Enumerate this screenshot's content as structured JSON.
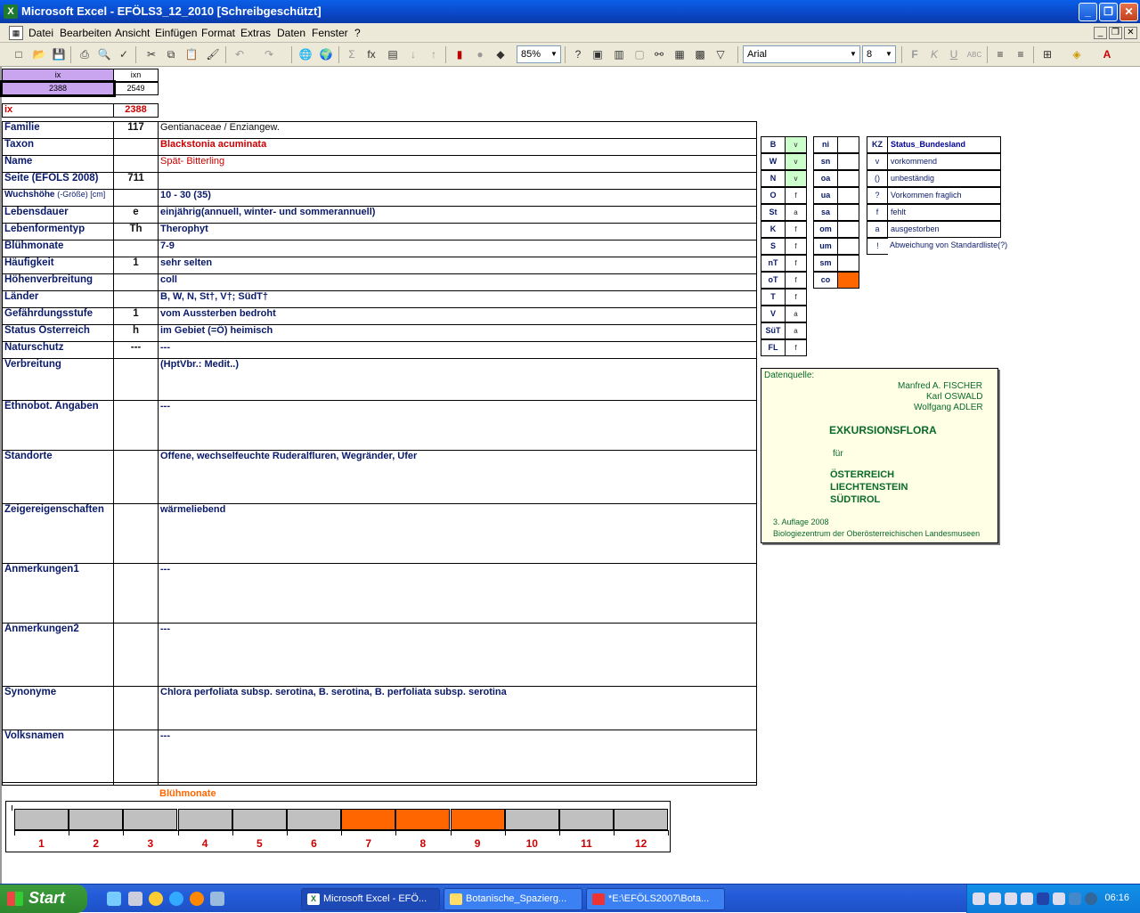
{
  "window": {
    "title": "Microsoft Excel - EFÖLS3_12_2010  [Schreibgeschützt]",
    "icon": "excel-icon"
  },
  "menu": [
    "Datei",
    "Bearbeiten",
    "Ansicht",
    "Einfügen",
    "Format",
    "Extras",
    "Daten",
    "Fenster",
    "?"
  ],
  "toolbar": {
    "zoom": "85%",
    "font": "Arial",
    "size": "8"
  },
  "index": {
    "ix_head": "ix",
    "ixn_head": "ixn",
    "ix_val": "2388",
    "ixn_val": "2549",
    "ix_label": "ix",
    "ix_red": "2388"
  },
  "rows": [
    {
      "label": "Familie",
      "num": "117",
      "val": "Gentianaceae  /  Enziangew."
    },
    {
      "label": "Taxon",
      "num": "",
      "val": "Blackstonia acuminata"
    },
    {
      "label": "Name",
      "num": "",
      "val": "Spät- Bitterling"
    },
    {
      "label": "Seite (EFÖLS 2008)",
      "num": "711",
      "val": ""
    },
    {
      "label": "Wuchshöhe",
      "sub": "(-Größe) [cm]",
      "num": "",
      "val": "10 - 30 (35)"
    },
    {
      "label": "Lebensdauer",
      "num": "e",
      "val": "einjährig(annuell, winter- und sommerannuell)"
    },
    {
      "label": "Lebenformentyp",
      "num": "Th",
      "val": "Therophyt"
    },
    {
      "label": "Blühmonate",
      "num": "",
      "val": "7-9"
    },
    {
      "label": "Häufigkeit",
      "num": "1",
      "val": "sehr selten"
    },
    {
      "label": "Höhenverbreitung",
      "num": "",
      "val": "coll"
    },
    {
      "label": "Länder",
      "num": "",
      "val": "B, W, N, St†, V†; SüdT†"
    },
    {
      "label": "Gefährdungsstufe",
      "num": "1",
      "val": "vom Aussterben bedroht"
    },
    {
      "label": "Status Österreich",
      "num": "h",
      "val": "im Gebiet (=Ö) heimisch"
    },
    {
      "label": "Naturschutz",
      "num": "---",
      "val": "---"
    }
  ],
  "tall_rows": [
    {
      "label": "Verbreitung",
      "val": "(HptVbr.: Medit..)"
    },
    {
      "label": "Ethnobot. Angaben",
      "val": "---"
    },
    {
      "label": "Standorte",
      "val": "Offene, wechselfeuchte Ruderalfluren, Wegränder, Ufer"
    },
    {
      "label": "Zeigereigenschaften",
      "val": "wärmeliebend"
    },
    {
      "label": "Anmerkungen1",
      "val": "---"
    },
    {
      "label": "Anmerkungen2",
      "val": "---"
    },
    {
      "label": "Synonyme",
      "val": "Chlora perfoliata subsp. serotina, B. serotina, B. perfoliata subsp. serotina"
    },
    {
      "label": "Volksnamen",
      "val": "---"
    }
  ],
  "codes1": [
    [
      "B",
      "v"
    ],
    [
      "W",
      "v"
    ],
    [
      "N",
      "v"
    ],
    [
      "O",
      "f"
    ],
    [
      "St",
      "a"
    ],
    [
      "K",
      "f"
    ],
    [
      "S",
      "f"
    ],
    [
      "nT",
      "f"
    ],
    [
      "oT",
      "f"
    ],
    [
      "T",
      "f"
    ],
    [
      "V",
      "a"
    ],
    [
      "SüT",
      "a"
    ],
    [
      "FL",
      "f"
    ]
  ],
  "codes2": [
    [
      "ni",
      ""
    ],
    [
      "sn",
      ""
    ],
    [
      "oa",
      ""
    ],
    [
      "ua",
      ""
    ],
    [
      "sa",
      ""
    ],
    [
      "om",
      ""
    ],
    [
      "um",
      ""
    ],
    [
      "sm",
      ""
    ],
    [
      "co",
      ""
    ]
  ],
  "legend": [
    [
      "KZ",
      "Status_Bundesland"
    ],
    [
      "v",
      "vorkommend"
    ],
    [
      "()",
      "unbeständig"
    ],
    [
      "?",
      "Vorkommen fraglich"
    ],
    [
      "f",
      "fehlt"
    ],
    [
      "a",
      "ausgestorben"
    ],
    [
      "!",
      "Abweichung von Standardliste(?)"
    ]
  ],
  "source": {
    "label": "Datenquelle:",
    "a1": "Manfred A. FISCHER",
    "a2": "Karl OSWALD",
    "a3": "Wolfgang ADLER",
    "t1": "EXKURSIONSFLORA",
    "t2": "für",
    "t3": "ÖSTERREICH",
    "t4": "LIECHTENSTEIN",
    "t5": "SÜDTIROL",
    "e1": "3. Auflage 2008",
    "e2": "Biologiezentrum der Oberösterreichischen Landesmuseen"
  },
  "bloom": {
    "title": "Blühmonate",
    "months": [
      "1",
      "2",
      "3",
      "4",
      "5",
      "6",
      "7",
      "8",
      "9",
      "10",
      "11",
      "12"
    ],
    "active": [
      7,
      8,
      9
    ],
    "active_color": "#ff6600",
    "inactive_color": "#c0c0c0"
  },
  "taskbar": {
    "start": "Start",
    "tasks": [
      "Microsoft Excel - EFÖ...",
      "Botanische_Spazierg...",
      "*E:\\EFÖLS2007\\Bota..."
    ],
    "clock": "06:16"
  }
}
